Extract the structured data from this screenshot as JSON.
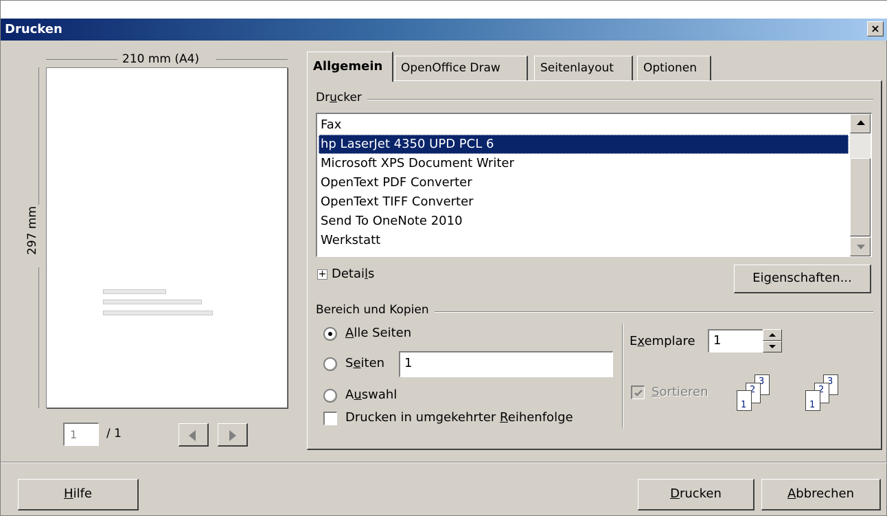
{
  "window": {
    "title": "Drucken",
    "close_glyph": "×"
  },
  "preview": {
    "width_label": "210 mm (A4)",
    "height_label": "297 mm",
    "page_value": "1",
    "page_total": "/ 1"
  },
  "tabs": [
    {
      "label": "Allgemein"
    },
    {
      "label": "OpenOffice Draw"
    },
    {
      "label": "Seitenlayout"
    },
    {
      "label": "Optionen"
    }
  ],
  "printer": {
    "group_label_pre": "Dr",
    "group_label_mn": "u",
    "group_label_post": "cker",
    "items": [
      "Fax",
      "hp LaserJet 4350 UPD PCL 6",
      "Microsoft XPS Document Writer",
      "OpenText PDF Converter",
      "OpenText TIFF Converter",
      "Send To OneNote 2010",
      "Werkstatt"
    ],
    "selected_index": 1,
    "details_pre": "Detai",
    "details_mn": "l",
    "details_post": "s",
    "properties_pre": "Ei",
    "properties_mn": "g",
    "properties_post": "enschaften..."
  },
  "range": {
    "group_label": "Bereich und Kopien",
    "all_pages_mn": "A",
    "all_pages_rest": "lle Seiten",
    "pages_pre": "S",
    "pages_mn": "e",
    "pages_post": "iten",
    "pages_value": "1",
    "selection_pre": "A",
    "selection_mn": "u",
    "selection_post": "swahl",
    "reverse_pre": "Drucken in umgekehrter ",
    "reverse_mn": "R",
    "reverse_post": "eihenfolge",
    "copies_pre": "E",
    "copies_mn": "x",
    "copies_post": "emplare",
    "copies_value": "1",
    "collate_mn": "S",
    "collate_rest": "ortieren",
    "collate_sheets": [
      "1",
      "2",
      "3"
    ]
  },
  "footer": {
    "help_mn": "H",
    "help_rest": "ilfe",
    "print_mn": "D",
    "print_rest": "rucken",
    "cancel_mn": "A",
    "cancel_rest": "bbrechen"
  }
}
